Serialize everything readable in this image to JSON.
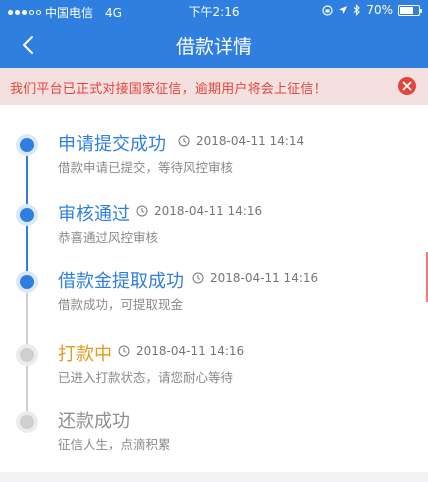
{
  "status_bar": {
    "carrier": "中国电信",
    "network": "4G",
    "time": "下午2:16",
    "battery": "70%"
  },
  "nav": {
    "title": "借款详情",
    "back_icon": "chevron-left-icon"
  },
  "notice": {
    "text": "我们平台已正式对接国家征信，逾期用户将会上征信！",
    "close_icon": "close-circle-icon"
  },
  "timeline": [
    {
      "title": "申请提交成功",
      "time": "2018-04-11 14:14",
      "desc": "借款申请已提交，等待风控审核",
      "state": "done"
    },
    {
      "title": "审核通过",
      "time": "2018-04-11 14:16",
      "desc": "恭喜通过风控审核",
      "state": "done"
    },
    {
      "title": "借款金提取成功",
      "time": "2018-04-11 14:16",
      "desc": "借款成功，可提取现金",
      "state": "done"
    },
    {
      "title": "打款中",
      "time": "2018-04-11 14:16",
      "desc": "已进入打款状态，请您耐心等待",
      "state": "active"
    },
    {
      "title": "还款成功",
      "time": "",
      "desc": "征信人生，点滴积累",
      "state": "todo"
    }
  ],
  "colors": {
    "primary": "#2f7fe0",
    "notice_bg": "#f5e0e0",
    "notice_text": "#e0463c",
    "active": "#e39a1e",
    "pending": "#cfcfcf"
  }
}
